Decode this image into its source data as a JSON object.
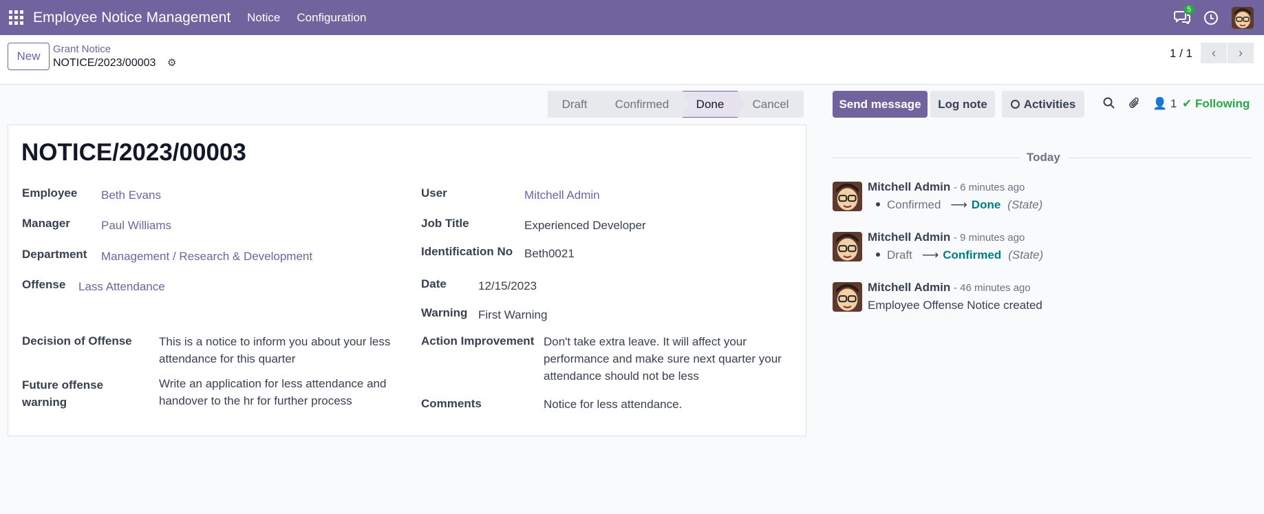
{
  "navbar": {
    "app_title": "Employee Notice Management",
    "menus": [
      "Notice",
      "Configuration"
    ],
    "chat_count": "5",
    "accent_color": "#71639e"
  },
  "control_panel": {
    "new_label": "New",
    "breadcrumb_parent": "Grant Notice",
    "breadcrumb_current": "NOTICE/2023/00003",
    "pager": "1 / 1"
  },
  "statusbar": {
    "stages": [
      "Draft",
      "Confirmed",
      "Done",
      "Cancel"
    ],
    "active": "Done"
  },
  "form": {
    "title": "NOTICE/2023/00003",
    "labels": {
      "employee": "Employee",
      "manager": "Manager",
      "department": "Department",
      "offense": "Offense",
      "user": "User",
      "job_title": "Job Title",
      "identification": "Identification No",
      "date": "Date",
      "warning": "Warning",
      "decision": "Decision of Offense",
      "future": "Future offense warning",
      "action": "Action Improvement",
      "comments": "Comments"
    },
    "values": {
      "employee": "Beth Evans",
      "manager": "Paul Williams",
      "department": "Management / Research & Development",
      "offense": "Lass Attendance",
      "user": "Mitchell Admin",
      "job_title": "Experienced Developer",
      "identification": "Beth0021",
      "date": "12/15/2023",
      "warning": "First Warning",
      "decision": "This is a notice to inform you about your less attendance for this quarter",
      "future": "Write an application for less attendance and handover to the hr for further process",
      "action": "Don't take extra leave. It will affect your performance and make sure next quarter your attendance should not be less",
      "comments": "Notice for less attendance."
    }
  },
  "chatter": {
    "send_message": "Send message",
    "log_note": "Log note",
    "activities": "Activities",
    "followers_count": "1",
    "following": "Following",
    "today": "Today",
    "messages": [
      {
        "author": "Mitchell Admin",
        "time": "- 6 minutes ago",
        "old": "Confirmed",
        "new": "Done",
        "field": "(State)"
      },
      {
        "author": "Mitchell Admin",
        "time": "- 9 minutes ago",
        "old": "Draft",
        "new": "Confirmed",
        "field": "(State)"
      },
      {
        "author": "Mitchell Admin",
        "time": "- 46 minutes ago",
        "text": "Employee Offense Notice created"
      }
    ]
  }
}
